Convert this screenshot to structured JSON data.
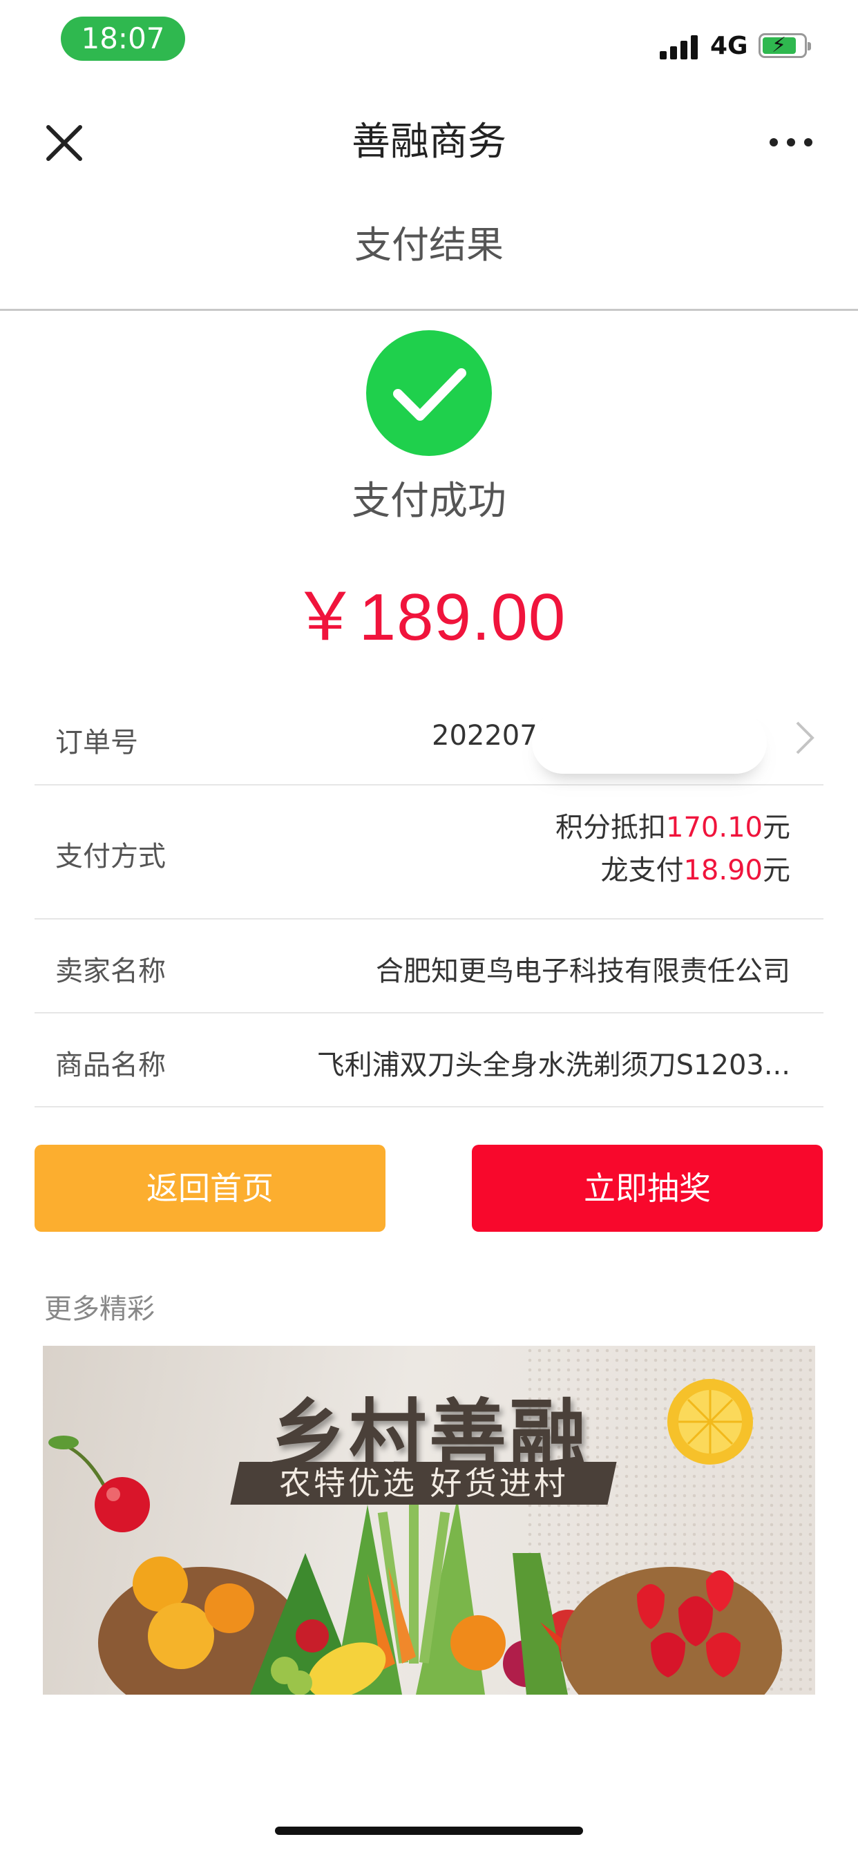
{
  "status_bar": {
    "time": "18:07",
    "network": "4G",
    "icons": [
      "signal-icon",
      "battery-charging-icon"
    ]
  },
  "nav": {
    "title": "善融商务",
    "close_icon": "close-icon",
    "more_icon": "more-icon"
  },
  "page": {
    "subtitle": "支付结果",
    "status_text": "支付成功",
    "amount": "￥189.00",
    "success_icon": "checkmark-icon"
  },
  "info": {
    "order": {
      "label": "订单号",
      "value": "202207"
    },
    "payment": {
      "label": "支付方式",
      "line1_prefix": "积分抵扣",
      "line1_amount": "170.10",
      "line1_unit": "元",
      "line2_prefix": "龙支付",
      "line2_amount": "18.90",
      "line2_unit": "元"
    },
    "seller": {
      "label": "卖家名称",
      "value": "合肥知更鸟电子科技有限责任公司"
    },
    "goods": {
      "label": "商品名称",
      "value": "飞利浦双刀头全身水洗剃须刀S1203..."
    }
  },
  "actions": {
    "home_label": "返回首页",
    "lottery_label": "立即抽奖"
  },
  "more": {
    "label": "更多精彩"
  },
  "banner": {
    "title": "乡村善融",
    "subtitle": "农特优选 好货进村"
  },
  "colors": {
    "accent_red": "#f0143c",
    "success_green": "#1fd04c",
    "home_button": "#fcae2f",
    "lottery_button": "#f8082c"
  }
}
